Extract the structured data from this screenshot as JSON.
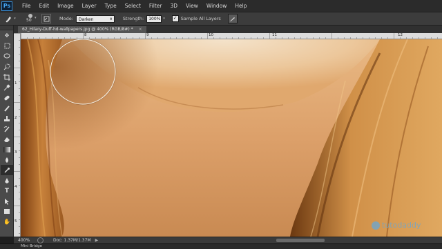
{
  "app": {
    "logo": "Ps"
  },
  "menu": [
    "File",
    "Edit",
    "Image",
    "Layer",
    "Type",
    "Select",
    "Filter",
    "3D",
    "View",
    "Window",
    "Help"
  ],
  "options": {
    "tool_icon": "burn-tool-icon",
    "brush_size": "50",
    "mode_label": "Mode:",
    "mode_value": "Darken",
    "strength_label": "Strength:",
    "strength_value": "100%",
    "sample_all_layers_label": "Sample All Layers",
    "sample_all_layers_checked": true
  },
  "document": {
    "tab_title": "62_Hilary-Duff-hd-wallpapers.jpg @ 400% (RGB/8#) *",
    "close_label": "×"
  },
  "ruler": {
    "top_labels": [
      "8",
      "9",
      "10",
      "11",
      "12"
    ],
    "left_labels": [
      "1",
      "2",
      "3",
      "4",
      "5",
      "6"
    ]
  },
  "status": {
    "zoom": "400%",
    "doc_info": "Doc: 1.37M/1.37M",
    "arrow": "▶"
  },
  "bottom": {
    "mini_bridge": "Mini Bridge"
  },
  "watermark": {
    "text": "tutodaddy"
  },
  "colors": {
    "skin_light": "#f0d8b8",
    "skin_mid": "#d89a5c",
    "skin_dark": "#b06a2e",
    "hair": "#c47a30",
    "ui_dark": "#2b2b2b",
    "ui_mid": "#3c3c3c",
    "ps_blue": "#45a6f2"
  },
  "tools": [
    "move-tool-icon",
    "marquee-tool-icon",
    "lasso-tool-icon",
    "quick-select-tool-icon",
    "crop-tool-icon",
    "eyedropper-tool-icon",
    "healing-tool-icon",
    "brush-tool-icon",
    "clone-stamp-tool-icon",
    "history-brush-tool-icon",
    "eraser-tool-icon",
    "gradient-tool-icon",
    "blur-tool-icon",
    "burn-tool-icon",
    "pen-tool-icon",
    "type-tool-icon",
    "path-select-tool-icon",
    "shape-tool-icon",
    "hand-tool-icon",
    "zoom-tool-icon"
  ]
}
